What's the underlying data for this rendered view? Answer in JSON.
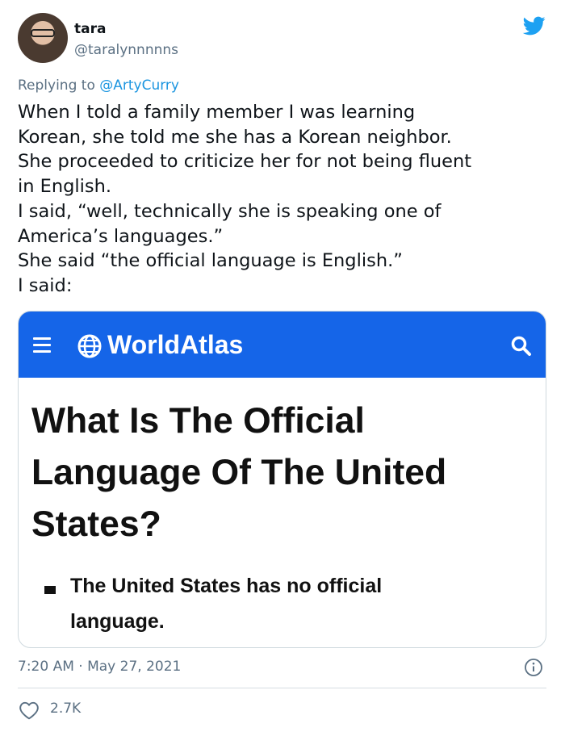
{
  "tweet": {
    "author_name": "tara",
    "author_handle": "@taralynnnnns",
    "reply_prefix": "Replying to ",
    "reply_to": "@ArtyCurry",
    "text_lines": [
      "When I told a family member I was learning",
      "Korean, she told me she has a Korean neighbor.",
      "She proceeded to criticize her for not being fluent",
      "in English.",
      "I said, “well, technically she is speaking one of",
      "America’s languages.”",
      "She said “the official language is English.”",
      "I said:"
    ],
    "timestamp": "7:20 AM · May 27, 2021",
    "likes": "2.7K"
  },
  "card": {
    "brand": "WorldAtlas",
    "title_lines": [
      "What Is The Official",
      "Language Of The United",
      "States?"
    ],
    "bullet_lines": [
      "The United States has no official",
      "language."
    ]
  },
  "icons": {
    "logo": "twitter-bird-icon",
    "menu": "hamburger-menu-icon",
    "globe": "globe-icon",
    "search": "search-icon",
    "info": "info-icon",
    "like": "heart-icon"
  },
  "colors": {
    "twitter_blue": "#1da1f2",
    "link_blue": "#1b95e0",
    "worldatlas_blue": "#1565e8",
    "muted_text": "#5b7083"
  }
}
